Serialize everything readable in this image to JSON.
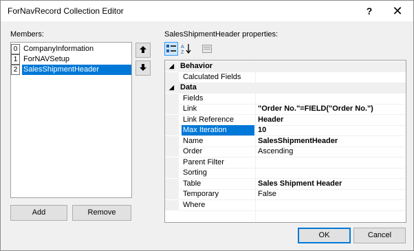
{
  "window": {
    "title": "ForNavRecord Collection Editor",
    "help_label": "?",
    "close_label": "✕"
  },
  "members": {
    "label": "Members:",
    "items": [
      {
        "index": "0",
        "name": "CompanyInformation"
      },
      {
        "index": "1",
        "name": "ForNAVSetup"
      },
      {
        "index": "2",
        "name": "SalesShipmentHeader"
      }
    ],
    "selected_index": 2,
    "up_label": "🡅",
    "down_label": "🡇",
    "add_label": "Add",
    "remove_label": "Remove"
  },
  "properties": {
    "label": "SalesShipmentHeader properties:",
    "toolbar": {
      "categorized_icon": "categorized-icon",
      "alphabetical_icon": "alphabetical-sort-icon",
      "pages_icon": "property-pages-icon"
    },
    "rows": [
      {
        "type": "category",
        "name": "Behavior",
        "expander": "◢"
      },
      {
        "type": "prop",
        "name": "Calculated Fields",
        "value": "",
        "bold": false
      },
      {
        "type": "category",
        "name": "Data",
        "expander": "◢"
      },
      {
        "type": "prop",
        "name": "Fields",
        "value": "",
        "bold": false
      },
      {
        "type": "prop",
        "name": "Link",
        "value": "\"Order No.\"=FIELD(\"Order No.\")",
        "bold": true
      },
      {
        "type": "prop",
        "name": "Link Reference",
        "value": "Header",
        "bold": true
      },
      {
        "type": "prop",
        "name": "Max Iteration",
        "value": "10",
        "bold": true,
        "selected": true
      },
      {
        "type": "prop",
        "name": "Name",
        "value": "SalesShipmentHeader",
        "bold": true
      },
      {
        "type": "prop",
        "name": "Order",
        "value": "Ascending",
        "bold": false
      },
      {
        "type": "prop",
        "name": "Parent Filter",
        "value": "",
        "bold": false
      },
      {
        "type": "prop",
        "name": "Sorting",
        "value": "",
        "bold": false
      },
      {
        "type": "prop",
        "name": "Table",
        "value": "Sales Shipment Header",
        "bold": true
      },
      {
        "type": "prop",
        "name": "Temporary",
        "value": "False",
        "bold": false
      },
      {
        "type": "prop",
        "name": "Where",
        "value": "",
        "bold": false
      }
    ]
  },
  "footer": {
    "ok_label": "OK",
    "cancel_label": "Cancel"
  },
  "colors": {
    "selection": "#0078d7",
    "background": "#f0f0f0"
  }
}
